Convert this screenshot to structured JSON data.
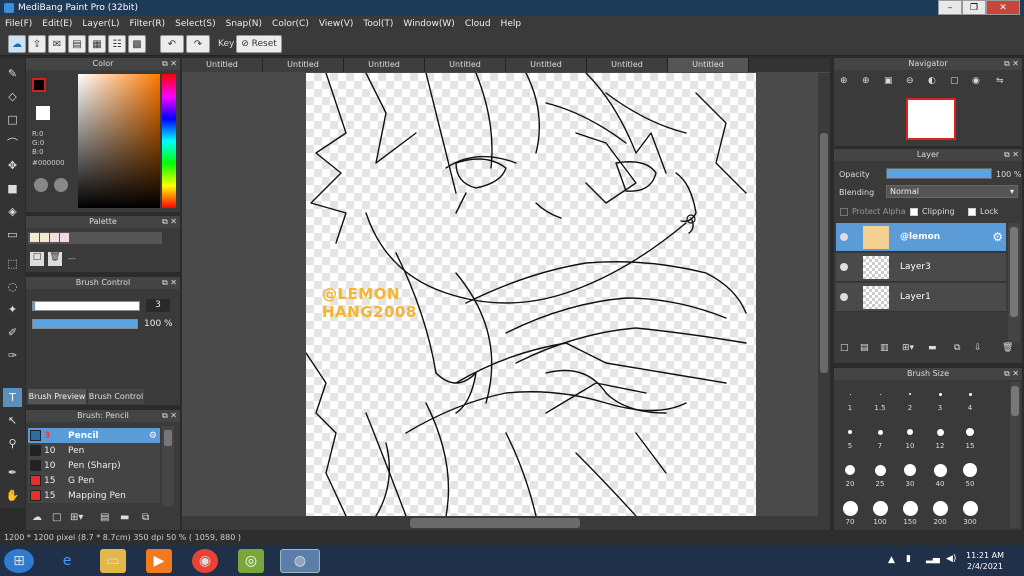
{
  "window": {
    "title": "MediBang Paint Pro (32bit)"
  },
  "menu": [
    "File(F)",
    "Edit(E)",
    "Layer(L)",
    "Filter(R)",
    "Select(S)",
    "Snap(N)",
    "Color(C)",
    "View(V)",
    "Tool(T)",
    "Window(W)",
    "Cloud",
    "Help"
  ],
  "toolbar": {
    "key_label": "Key",
    "reset_label": "Reset"
  },
  "tabs": [
    "Untitled",
    "Untitled",
    "Untitled",
    "Untitled",
    "Untitled",
    "Untitled",
    "Untitled"
  ],
  "color_panel": {
    "title": "Color",
    "r": "R:0",
    "g": "G:0",
    "b": "B:0",
    "hex": "#000000"
  },
  "palette_panel": {
    "title": "Palette",
    "swatches": [
      "#f3ecc8",
      "#f6e7d0",
      "#f5dede",
      "#f8d8e0"
    ],
    "mini_label": "---"
  },
  "brush_control": {
    "title": "Brush Control",
    "size_value": "3",
    "opacity_value": "100 %",
    "tab_preview": "Brush Preview",
    "tab_control": "Brush Control"
  },
  "brush_panel": {
    "title": "Brush: Pencil",
    "items": [
      {
        "size": "3",
        "name": "Pencil",
        "color": "#2a6ea8"
      },
      {
        "size": "10",
        "name": "Pen",
        "color": "#222222"
      },
      {
        "size": "10",
        "name": "Pen (Sharp)",
        "color": "#222222"
      },
      {
        "size": "15",
        "name": "G Pen",
        "color": "#e03030"
      },
      {
        "size": "15",
        "name": "Mapping Pen",
        "color": "#e03030"
      }
    ]
  },
  "navigator": {
    "title": "Navigator"
  },
  "layer_panel": {
    "title": "Layer",
    "opacity_label": "Opacity",
    "opacity_value": "100 %",
    "opacity_fraction": 1.0,
    "blending_label": "Blending",
    "blending_value": "Normal",
    "protect_alpha": "Protect Alpha",
    "clipping": "Clipping",
    "lock": "Lock",
    "layers": [
      "@lemon",
      "Layer3",
      "Layer1"
    ]
  },
  "brush_size": {
    "title": "Brush Size",
    "sizes": [
      "1",
      "1.5",
      "2",
      "3",
      "4",
      "5",
      "7",
      "10",
      "12",
      "15",
      "20",
      "25",
      "30",
      "40",
      "50",
      "70",
      "100",
      "150",
      "200",
      "300"
    ]
  },
  "canvas": {
    "watermark_line1": "@LEMON",
    "watermark_line2": "HANG2008"
  },
  "status": {
    "text": "1200 * 1200 pixel   (8.7 * 8.7cm)   350 dpi   50 %   ( 1059, 880 )"
  },
  "taskbar": {
    "time": "11:21 AM",
    "date": "2/4/2021"
  },
  "colors": {
    "accent": "#5a9bd8",
    "watermark": "#f5b533"
  }
}
